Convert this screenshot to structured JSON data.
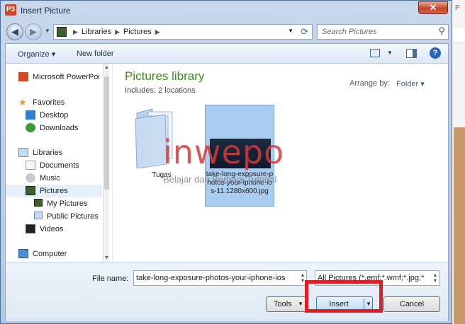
{
  "window": {
    "title": "Insert Picture",
    "app_icon": "P3",
    "close_glyph": "✕"
  },
  "address_bar": {
    "breadcrumbs": [
      "Libraries",
      "Pictures"
    ],
    "search_placeholder": "Search Pictures"
  },
  "toolbar": {
    "organize": "Organize ▾",
    "new_folder": "New folder"
  },
  "nav_pane": {
    "items": [
      {
        "label": "Microsoft PowerPoi",
        "icon": "powerpoint-icon"
      },
      {
        "label": "Favorites",
        "icon": "star-icon"
      },
      {
        "label": "Desktop",
        "icon": "desktop-icon"
      },
      {
        "label": "Downloads",
        "icon": "downloads-icon"
      },
      {
        "label": "Libraries",
        "icon": "libraries-icon"
      },
      {
        "label": "Documents",
        "icon": "documents-icon"
      },
      {
        "label": "Music",
        "icon": "music-icon"
      },
      {
        "label": "Pictures",
        "icon": "pictures-icon",
        "selected": true
      },
      {
        "label": "My Pictures",
        "icon": "folder-icon"
      },
      {
        "label": "Public Pictures",
        "icon": "folder-icon"
      },
      {
        "label": "Videos",
        "icon": "videos-icon"
      },
      {
        "label": "Computer",
        "icon": "computer-icon"
      }
    ]
  },
  "content": {
    "library_title": "Pictures library",
    "includes": "Includes:  2 locations",
    "arrange_label": "Arrange by:",
    "arrange_value": "Folder ▾",
    "files": [
      {
        "name": "Tugas",
        "type": "folder"
      },
      {
        "name": "take-long-exposure-photos-your-iphone-ios-11.1280x600.jpg",
        "type": "image"
      }
    ]
  },
  "watermark": {
    "brand": "inwepo",
    "tagline": "Belajar dan Berbagi Tutorial"
  },
  "bottom": {
    "file_name_label": "File name:",
    "file_name_value": "take-long-exposure-photos-your-iphone-ios",
    "file_type_value": "All Pictures (*.emf;*.wmf;*.jpg;*",
    "tools_label": "Tools",
    "insert_label": "Insert",
    "cancel_label": "Cancel"
  },
  "colors": {
    "accent_green": "#3c8c1e",
    "highlight_red": "#e01e25",
    "selection_blue": "#a9cdf0"
  }
}
